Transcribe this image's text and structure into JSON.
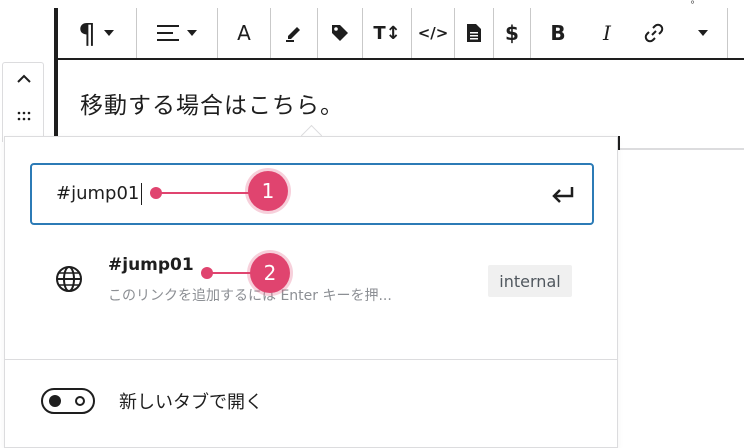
{
  "toolbar": {
    "items": [
      {
        "name": "paragraph-icon",
        "glyph": "¶"
      },
      {
        "name": "align-icon"
      },
      {
        "name": "text-color",
        "text": "A"
      },
      {
        "name": "highlight-icon"
      },
      {
        "name": "tag-icon"
      },
      {
        "name": "text-size-icon",
        "text": "T↕"
      },
      {
        "name": "code-icon",
        "text": "</>"
      },
      {
        "name": "document-icon"
      },
      {
        "name": "dollar-icon",
        "text": "$"
      },
      {
        "name": "bold",
        "text": "B"
      },
      {
        "name": "italic",
        "text": "I"
      },
      {
        "name": "link-icon"
      },
      {
        "name": "more-options-chevron-icon"
      }
    ]
  },
  "editor": {
    "paragraph_text": "移動する場合はこちら。"
  },
  "link_popover": {
    "url_value": "#jump01",
    "suggestion": {
      "title": "#jump01",
      "subtitle": "このリンクを追加するには Enter キーを押...",
      "badge": "internal"
    },
    "new_tab_label": "新しいタブで開く",
    "new_tab_enabled": false
  },
  "annotations": [
    {
      "label": "1"
    },
    {
      "label": "2"
    }
  ],
  "colors": {
    "input_focus_border": "#2c7bb6",
    "annotation": "#e0446f",
    "text": "#1e1e1e",
    "muted_text": "#8c8f94"
  }
}
